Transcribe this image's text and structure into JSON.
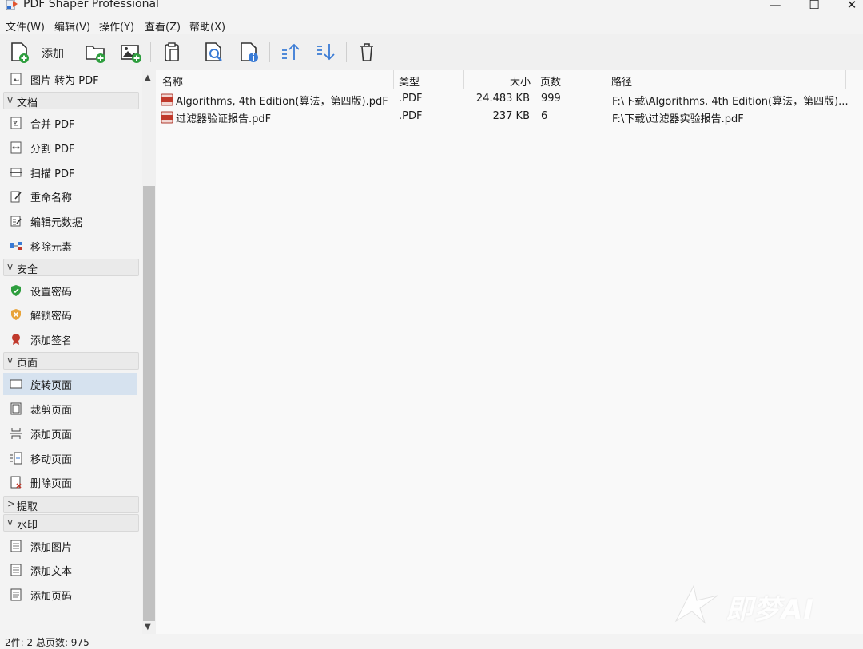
{
  "window": {
    "title": "PDF Shaper Professional",
    "controls": {
      "minimize": "—",
      "maximize": "☐",
      "close": "✕"
    }
  },
  "menu": [
    {
      "label": "文件(W)"
    },
    {
      "label": "编辑(V)"
    },
    {
      "label": "操作(Y)"
    },
    {
      "label": "查看(Z)"
    },
    {
      "label": "帮助(X)"
    }
  ],
  "toolbar": {
    "add_label": "添加",
    "buttons": [
      "add-file-icon",
      "add-folder-icon",
      "add-image-icon",
      "paste-icon",
      "preview-icon",
      "info-icon",
      "move-up-icon",
      "move-down-icon",
      "trash-icon"
    ]
  },
  "sidebar": {
    "top_item": "图片 转为 PDF",
    "groups": [
      {
        "label": "文档",
        "chevron": "v",
        "items": [
          "合并 PDF",
          "分割 PDF",
          "扫描 PDF",
          "重命名称",
          "编辑元数据",
          "移除元素"
        ]
      },
      {
        "label": "安全",
        "chevron": "v",
        "items": [
          "设置密码",
          "解锁密码",
          "添加签名"
        ]
      },
      {
        "label": "页面",
        "chevron": "v",
        "items": [
          "旋转页面",
          "裁剪页面",
          "添加页面",
          "移动页面",
          "删除页面"
        ],
        "selected": "旋转页面"
      },
      {
        "label": "提取",
        "chevron": ">"
      },
      {
        "label": "水印",
        "chevron": "v",
        "items": [
          "添加图片",
          "添加文本",
          "添加页码"
        ]
      }
    ]
  },
  "columns": {
    "name": "名称",
    "type": "类型",
    "size": "大小",
    "pages": "页数",
    "path": "路径"
  },
  "files": [
    {
      "name": "Algorithms, 4th Edition(算法，第四版).pdF",
      "type": ".PDF",
      "size": "24.483 KB",
      "pages": "999",
      "path": "F:\\下载\\Algorithms, 4th Edition(算法，第四版)..."
    },
    {
      "name": "过滤器验证报告.pdF",
      "type": ".PDF",
      "size": "237 KB",
      "pages": "6",
      "path": "F:\\下载\\过滤器实验报告.pdF"
    }
  ],
  "status": "2件: 2  总页数: 975",
  "watermark": "即梦AI",
  "colors": {
    "accent_green": "#2e9e3e",
    "selection": "#d6e2ef",
    "pdf_red": "#c0392b",
    "arrow_blue": "#3a7bd5"
  }
}
